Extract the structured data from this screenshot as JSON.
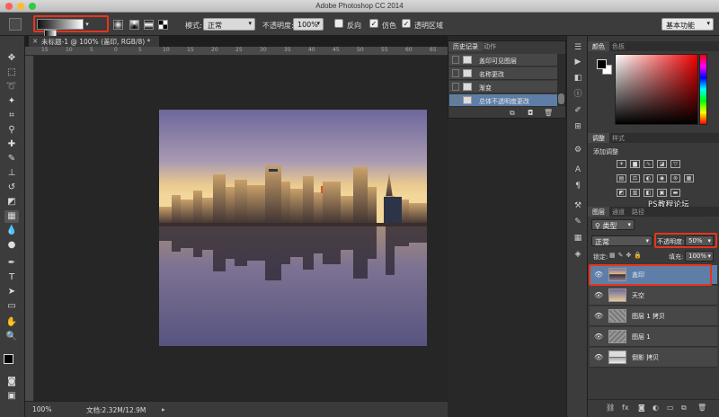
{
  "window": {
    "title": "Adobe Photoshop CC 2014"
  },
  "options": {
    "mode_label": "模式:",
    "mode_value": "正常",
    "opacity_label": "不透明度:",
    "opacity_value": "100%",
    "reverse_label": "反向",
    "dither_label": "仿色",
    "transparency_label": "透明区域",
    "reverse_checked": false,
    "dither_checked": true,
    "transparency_checked": true,
    "workspace": "基本功能",
    "highlight_color": "#e8341c"
  },
  "document": {
    "tab_title": "未标题-1 @ 100% (盖印, RGB/8) *",
    "ruler_ticks": [
      "15",
      "10",
      "5",
      "0",
      "5",
      "10",
      "15",
      "20",
      "25",
      "30",
      "35",
      "40",
      "45",
      "50",
      "55",
      "60",
      "65"
    ],
    "zoom": "100%",
    "doc_size": "文档:2.32M/12.9M"
  },
  "history": {
    "tabs": [
      "历史记录",
      "动作"
    ],
    "items": [
      {
        "label": "盖印可见图层",
        "selected": false
      },
      {
        "label": "名称更改",
        "selected": false
      },
      {
        "label": "渐变",
        "selected": false
      },
      {
        "label": "总体不透明度更改",
        "selected": true
      }
    ]
  },
  "color_panel": {
    "tabs": [
      "颜色",
      "色板"
    ]
  },
  "adjustments": {
    "tabs": [
      "调整",
      "样式"
    ],
    "title": "添加调整"
  },
  "layers": {
    "tabs": [
      "图层",
      "通道",
      "路径"
    ],
    "filter": "类型",
    "blend_mode": "正常",
    "opacity_label": "不透明度:",
    "opacity_value": "50%",
    "lock_label": "锁定:",
    "fill_label": "填充:",
    "fill_value": "100%",
    "items": [
      {
        "name": "盖印",
        "selected": true
      },
      {
        "name": "天空",
        "selected": false
      },
      {
        "name": "图层 1 拷贝",
        "selected": false
      },
      {
        "name": "图层 1",
        "selected": false
      },
      {
        "name": "倒影 拷贝",
        "selected": false
      }
    ]
  },
  "watermark": {
    "line1": "PS教程论坛",
    "line2": "BBS.16XX8.COM"
  }
}
